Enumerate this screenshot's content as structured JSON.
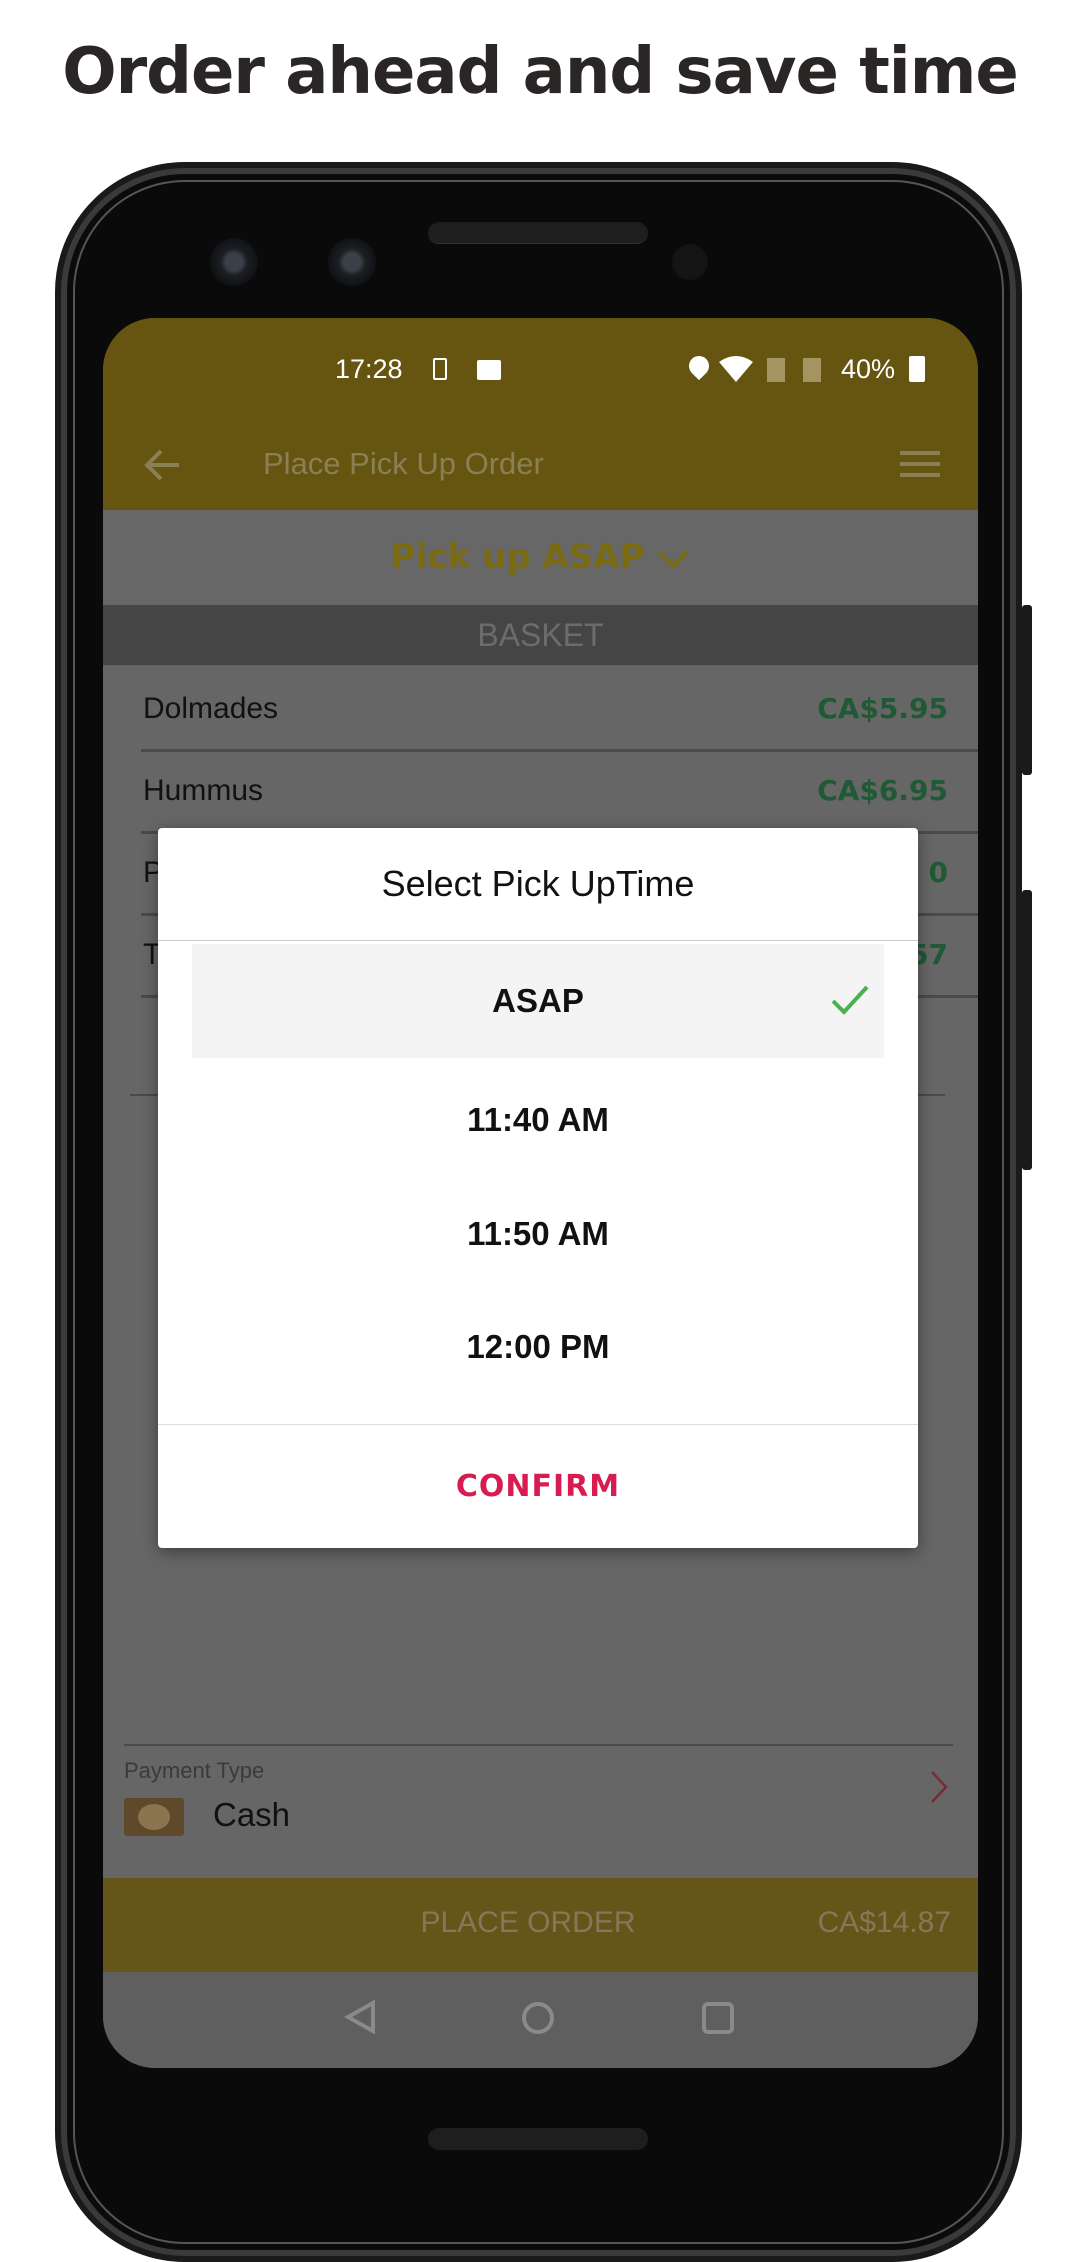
{
  "headline": "Order ahead and save time",
  "status_bar": {
    "time": "17:28",
    "battery": "40%",
    "icons": [
      "download-notification-icon",
      "image-notification-icon",
      "location-icon",
      "wifi-icon",
      "no-sim-icon",
      "no-sim-icon",
      "battery-icon"
    ]
  },
  "app_bar": {
    "title": "Place Pick Up Order",
    "back_icon": "arrow-left-icon",
    "menu_icon": "hamburger-menu-icon"
  },
  "pickup": {
    "label": "Pick up ASAP",
    "icon": "chevron-down-icon"
  },
  "basket": {
    "header": "BASKET",
    "items": [
      {
        "name": "Dolmades",
        "price": "CA$5.95"
      },
      {
        "name": "Hummus",
        "price": "CA$6.95"
      },
      {
        "name": "P",
        "price": "0"
      },
      {
        "name": "T",
        "price": "57"
      }
    ]
  },
  "payment": {
    "label": "Payment Type",
    "value": "Cash",
    "icon": "cash-icon"
  },
  "place_order": {
    "label": "PLACE ORDER",
    "total": "CA$14.87"
  },
  "dialog": {
    "title": "Select Pick UpTime",
    "options": [
      "ASAP",
      "11:40 AM",
      "11:50 AM",
      "12:00 PM"
    ],
    "selected": "ASAP",
    "confirm": "CONFIRM"
  },
  "colors": {
    "accent": "#665510",
    "confirm": "#d81b50",
    "check": "#4caf50",
    "price": "#1f5a34"
  }
}
